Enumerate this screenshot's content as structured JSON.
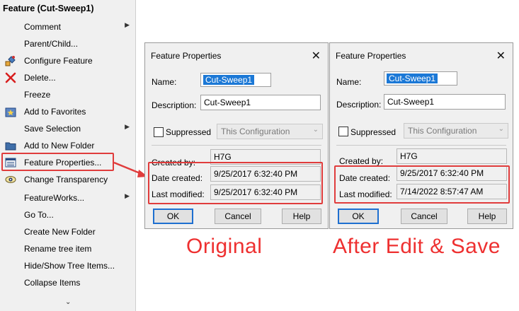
{
  "menu": {
    "title": "Feature (Cut-Sweep1)",
    "items": [
      {
        "label": "Comment",
        "icon": "none",
        "submenu": true
      },
      {
        "label": "Parent/Child...",
        "icon": "none",
        "submenu": false
      },
      {
        "label": "Configure Feature",
        "icon": "configure-feature-icon",
        "submenu": false
      },
      {
        "label": "Delete...",
        "icon": "delete-x-icon",
        "submenu": false
      },
      {
        "label": "Freeze",
        "icon": "none",
        "submenu": false
      },
      {
        "label": "Add to Favorites",
        "icon": "favorites-star-icon",
        "submenu": false
      },
      {
        "label": "Save Selection",
        "icon": "none",
        "submenu": true
      },
      {
        "label": "Add to New Folder",
        "icon": "folder-icon",
        "submenu": false
      },
      {
        "label": "Feature Properties...",
        "icon": "properties-list-icon",
        "submenu": false
      },
      {
        "label": "Change Transparency",
        "icon": "transparency-eye-icon",
        "submenu": false
      },
      {
        "label": "FeatureWorks...",
        "icon": "none",
        "submenu": true
      },
      {
        "label": "Go To...",
        "icon": "none",
        "submenu": false
      },
      {
        "label": "Create New Folder",
        "icon": "none",
        "submenu": false
      },
      {
        "label": "Rename tree item",
        "icon": "none",
        "submenu": false
      },
      {
        "label": "Hide/Show Tree Items...",
        "icon": "none",
        "submenu": false
      },
      {
        "label": "Collapse Items",
        "icon": "none",
        "submenu": false
      }
    ],
    "more_glyph": "⌄"
  },
  "dialogs": [
    {
      "title": "Feature Properties",
      "name_label": "Name:",
      "name_value": "Cut-Sweep1",
      "description_label": "Description:",
      "description_value": "Cut-Sweep1",
      "suppressed_label": "Suppressed",
      "configuration": "This Configuration",
      "created_by_label": "Created by:",
      "created_by": "H7G",
      "date_created_label": "Date created:",
      "date_created": "9/25/2017 6:32:40 PM",
      "last_modified_label": "Last modified:",
      "last_modified": "9/25/2017 6:32:40 PM",
      "ok": "OK",
      "cancel": "Cancel",
      "help": "Help"
    },
    {
      "title": "Feature Properties",
      "name_label": "Name:",
      "name_value": "Cut-Sweep1",
      "description_label": "Description:",
      "description_value": "Cut-Sweep1",
      "suppressed_label": "Suppressed",
      "configuration": "This Configuration",
      "created_by_label": "Created by:",
      "created_by": "H7G",
      "date_created_label": "Date created:",
      "date_created": "9/25/2017 6:32:40 PM",
      "last_modified_label": "Last modified:",
      "last_modified": "7/14/2022 8:57:47 AM",
      "ok": "OK",
      "cancel": "Cancel",
      "help": "Help"
    }
  ],
  "captions": {
    "left": "Original",
    "right": "After Edit & Save"
  },
  "colors": {
    "annotation": "#e03c3c",
    "selection": "#1b78d6",
    "ok_border": "#1e6fd0"
  }
}
